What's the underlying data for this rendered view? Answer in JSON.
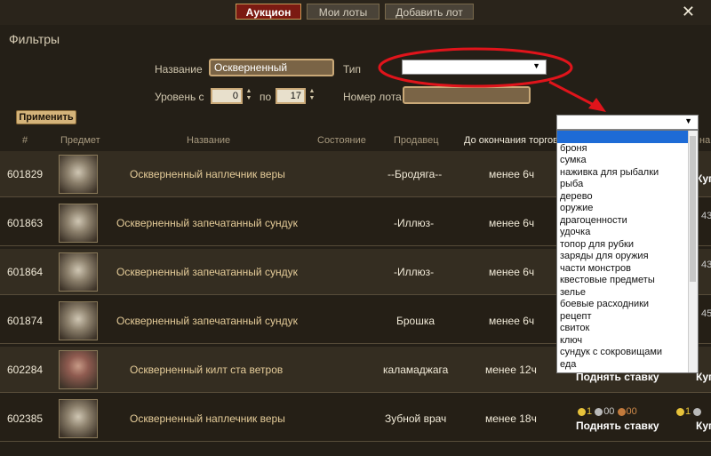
{
  "tabs": [
    {
      "label": "Аукцион",
      "active": true
    },
    {
      "label": "Мои лоты",
      "active": false
    },
    {
      "label": "Добавить лот",
      "active": false
    }
  ],
  "close_glyph": "✕",
  "filters": {
    "title": "Фильтры",
    "name_label": "Название",
    "name_value": "Оскверненный",
    "type_label": "Тип",
    "level_from_label": "Уровень с",
    "level_from": "0",
    "level_to_label": "по",
    "level_to": "17",
    "lot_label": "Номер лота",
    "lot_value": "",
    "apply_label": "Применить"
  },
  "columns": {
    "num": "#",
    "item": "Предмет",
    "name": "Название",
    "state": "Состояние",
    "seller": "Продавец",
    "time_left": "До окончания торгов",
    "price_partial": "на"
  },
  "rows": [
    {
      "id": "601829",
      "name": "Оскверненный наплечник веры",
      "seller": "--Бродяга--",
      "time": "менее 6ч",
      "right_partial": "Куп",
      "thumb": "shoulder"
    },
    {
      "id": "601863",
      "name": "Оскверненный запечатанный сундук",
      "seller": "-Иллюз-",
      "time": "менее 6ч",
      "right_partial": "43",
      "thumb": "chest"
    },
    {
      "id": "601864",
      "name": "Оскверненный запечатанный сундук",
      "seller": "-Иллюз-",
      "time": "менее 6ч",
      "right_partial": "43",
      "thumb": "chest"
    },
    {
      "id": "601874",
      "name": "Оскверненный запечатанный сундук",
      "seller": "Брошка",
      "time": "менее 6ч",
      "right_partial": "45",
      "thumb": "chest"
    },
    {
      "id": "602284",
      "name": "Оскверненный килт ста ветров",
      "seller": "каламаджага",
      "time": "менее 12ч",
      "bid_label": "Поднять ставку",
      "right_partial": "Куп",
      "thumb": "kilt"
    },
    {
      "id": "602385",
      "name": "Оскверненный наплечник веры",
      "seller": "Зубной врач",
      "time": "менее 18ч",
      "bid_gold": "1",
      "bid_silver": "00",
      "bid_copper": "00",
      "bid_label": "Поднять ставку",
      "right_gold": "1",
      "right_partial": "Куп",
      "thumb": "shoulder"
    }
  ],
  "type_dropdown": {
    "options": [
      "",
      "броня",
      "сумка",
      "наживка для рыбалки",
      "рыба",
      "дерево",
      "оружие",
      "драгоценности",
      "удочка",
      "топор для рубки",
      "заряды для оружия",
      "части монстров",
      "квестовые предметы",
      "зелье",
      "боевые расходники",
      "рецепт",
      "свиток",
      "ключ",
      "сундук с сокровищами",
      "еда"
    ]
  },
  "annotation": {
    "color": "#e0141b"
  }
}
